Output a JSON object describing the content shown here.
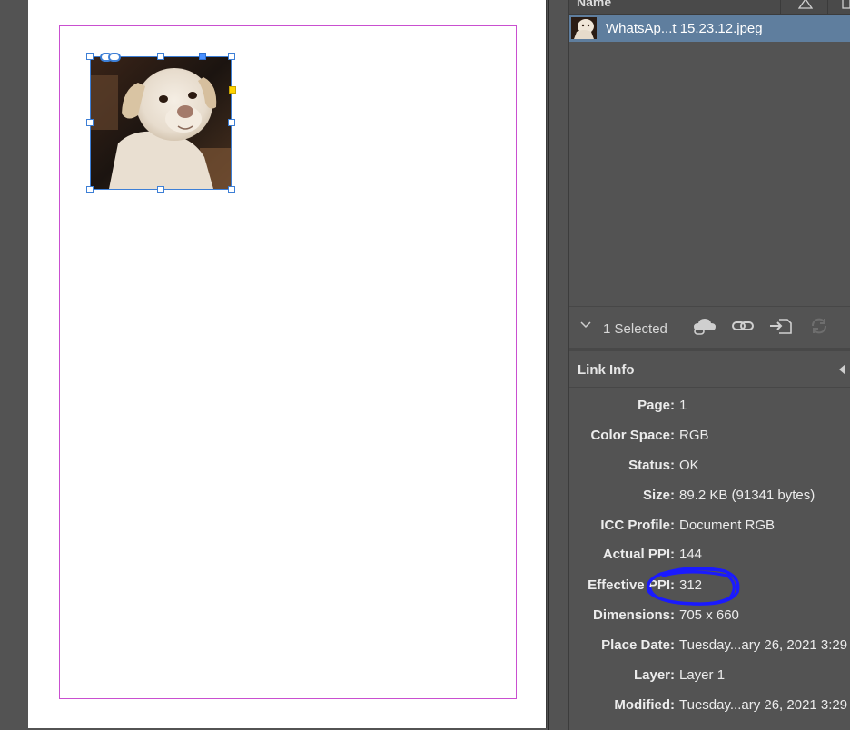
{
  "canvas": {
    "accent_margin_color": "#c94fd0",
    "selection_color": "#3d7fd6"
  },
  "links_panel": {
    "column_name": "Name",
    "file_name": "WhatsAp...t 15.23.12.jpeg",
    "selected_count": "1 Selected",
    "row_highlight": "#5f7e9e"
  },
  "link_info": {
    "title": "Link Info",
    "rows": [
      {
        "label": "Page:",
        "value": "1"
      },
      {
        "label": "Color Space:",
        "value": "RGB"
      },
      {
        "label": "Status:",
        "value": "OK"
      },
      {
        "label": "Size:",
        "value": "89.2 KB (91341 bytes)"
      },
      {
        "label": "ICC Profile:",
        "value": "Document RGB"
      },
      {
        "label": "Actual PPI:",
        "value": "144"
      },
      {
        "label": "Effective PPI:",
        "value": "312"
      },
      {
        "label": "Dimensions:",
        "value": "705 x 660"
      },
      {
        "label": "Place Date:",
        "value": "Tuesday...ary 26, 2021 3:29"
      },
      {
        "label": "Layer:",
        "value": "Layer 1"
      },
      {
        "label": "Modified:",
        "value": "Tuesday...ary 26, 2021 3:29"
      }
    ]
  },
  "icons": {
    "header_warning": "warning-triangle-icon",
    "chevron": "chevron-down-icon",
    "cloud": "cloud-link-icon",
    "relink": "relink-chain-icon",
    "goto": "go-to-link-icon",
    "update": "update-link-icon",
    "frame_link": "chain-link-badge-icon"
  },
  "annotation": {
    "scribble_color": "#1a1aff"
  }
}
